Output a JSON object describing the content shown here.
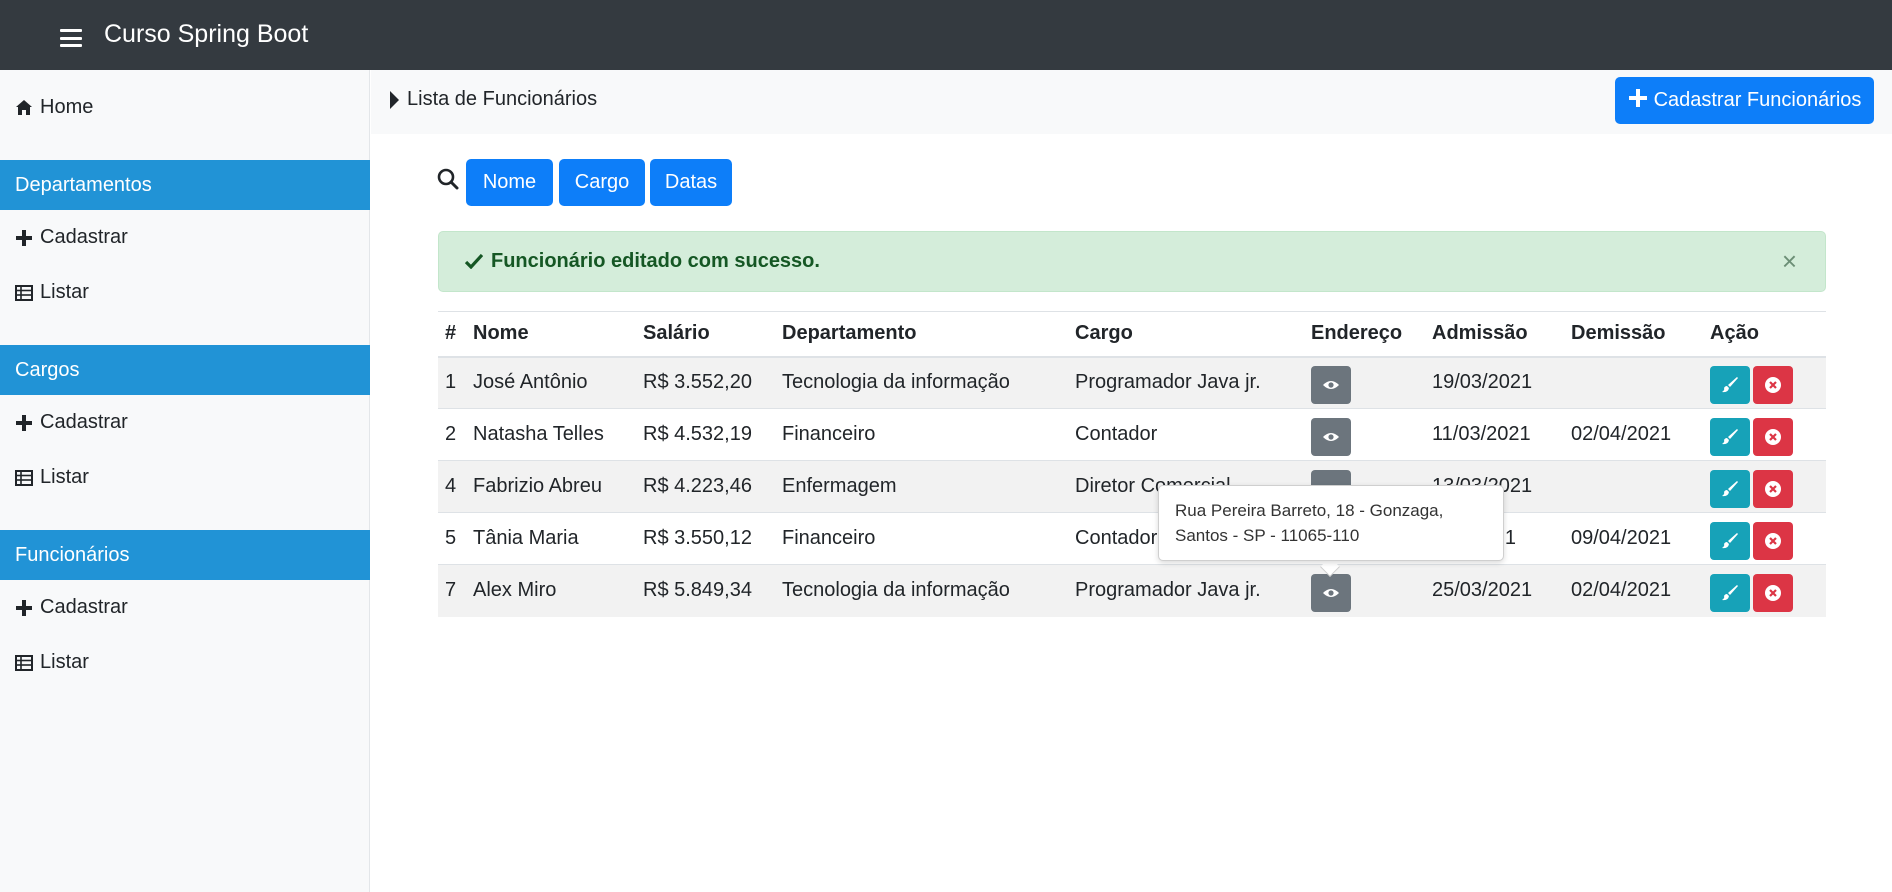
{
  "app": {
    "title": "Curso Spring Boot"
  },
  "sidebar": {
    "home": "Home",
    "sections": [
      {
        "title": "Departamentos",
        "items": [
          "Cadastrar",
          "Listar"
        ]
      },
      {
        "title": "Cargos",
        "items": [
          "Cadastrar",
          "Listar"
        ]
      },
      {
        "title": "Funcionários",
        "items": [
          "Cadastrar",
          "Listar"
        ]
      }
    ]
  },
  "breadcrumb": "Lista de Funcionários",
  "header_button": "Cadastrar Funcionários",
  "filters": [
    "Nome",
    "Cargo",
    "Datas"
  ],
  "alert": {
    "message": "Funcionário editado com sucesso.",
    "close": "×"
  },
  "table": {
    "headers": [
      "#",
      "Nome",
      "Salário",
      "Departamento",
      "Cargo",
      "Endereço",
      "Admissão",
      "Demissão",
      "Ação"
    ],
    "rows": [
      {
        "id": "1",
        "nome": "José Antônio",
        "salario": "R$ 3.552,20",
        "departamento": "Tecnologia da informação",
        "cargo": "Programador Java jr.",
        "admissao": "19/03/2021",
        "demissao": ""
      },
      {
        "id": "2",
        "nome": "Natasha Telles",
        "salario": "R$ 4.532,19",
        "departamento": "Financeiro",
        "cargo": "Contador",
        "admissao": "11/03/2021",
        "demissao": "02/04/2021"
      },
      {
        "id": "4",
        "nome": "Fabrizio Abreu",
        "salario": "R$ 4.223,46",
        "departamento": "Enfermagem",
        "cargo": "Diretor Comercial",
        "admissao": "13/03/2021",
        "demissao": ""
      },
      {
        "id": "5",
        "nome": "Tânia Maria",
        "salario": "R$ 3.550,12",
        "departamento": "Financeiro",
        "cargo": "Contador",
        "admissao": "21",
        "demissao": "09/04/2021"
      },
      {
        "id": "7",
        "nome": "Alex Miro",
        "salario": "R$ 5.849,34",
        "departamento": "Tecnologia da informação",
        "cargo": "Programador Java jr.",
        "admissao": "25/03/2021",
        "demissao": "02/04/2021"
      }
    ]
  },
  "tooltip": {
    "line1": "Rua Pereira Barreto, 18 - Gonzaga,",
    "line2": "Santos - SP - 11065-110"
  },
  "colors": {
    "topbar": "#343a40",
    "sidebar_header": "#2193d6",
    "primary": "#0d7ef9",
    "success_bg": "#d4edda",
    "edit": "#17a2b8",
    "delete": "#dc3545",
    "view": "#6c757d"
  }
}
